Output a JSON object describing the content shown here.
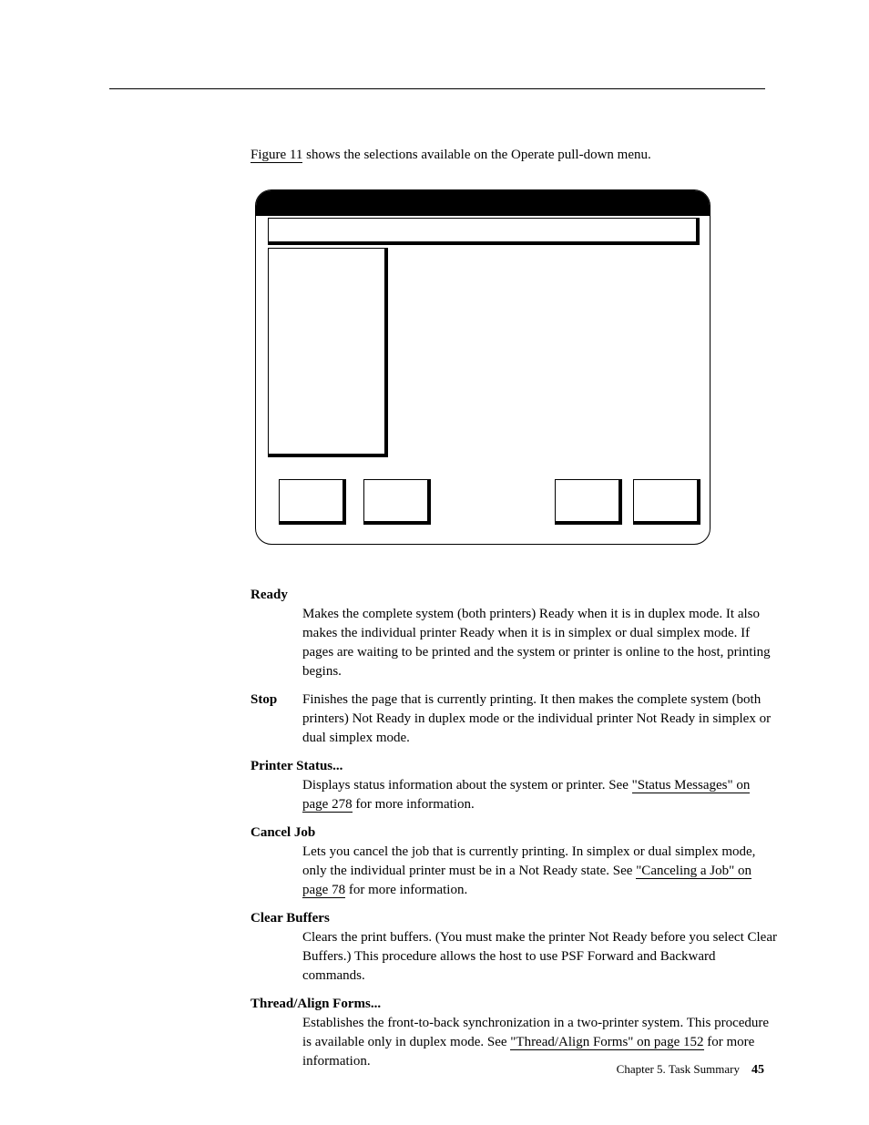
{
  "intro": {
    "link": "Figure 11",
    "text": " shows the selections available on the Operate pull-down menu."
  },
  "definitions": {
    "ready": {
      "term": "Ready",
      "body": "Makes the complete system (both printers) Ready when it is in duplex mode. It also makes the individual printer Ready when it is in simplex or dual simplex mode. If pages are waiting to be printed and the system or printer is online to the host, printing begins."
    },
    "stop": {
      "term": "Stop",
      "body": "Finishes the page that is currently printing. It then makes the complete system (both printers) Not Ready in duplex mode or the individual printer Not Ready in simplex or dual simplex mode."
    },
    "printer_status": {
      "term": "Printer Status...",
      "body_pre": "Displays status information about the system or printer. See ",
      "link": "\"Status Messages\" on page 278",
      "body_post": " for more information."
    },
    "cancel_job": {
      "term": "Cancel Job",
      "body_pre": "Lets you cancel the job that is currently printing. In simplex or dual simplex mode, only the individual printer must be in a Not Ready state. See ",
      "link": "\"Canceling a Job\" on page 78",
      "body_post": " for more information."
    },
    "clear_buffers": {
      "term": "Clear Buffers",
      "body": "Clears the print buffers. (You must make the printer Not Ready before you select Clear Buffers.) This procedure allows the host to use PSF Forward and Backward commands."
    },
    "thread_align": {
      "term": "Thread/Align Forms...",
      "body_pre": "Establishes the front-to-back synchronization in a two-printer system. This procedure is available only in duplex mode. See ",
      "link": "\"Thread/Align Forms\" on page 152",
      "body_post": " for more information."
    }
  },
  "footer": {
    "chapter": "Chapter 5. Task Summary",
    "page": "45"
  }
}
